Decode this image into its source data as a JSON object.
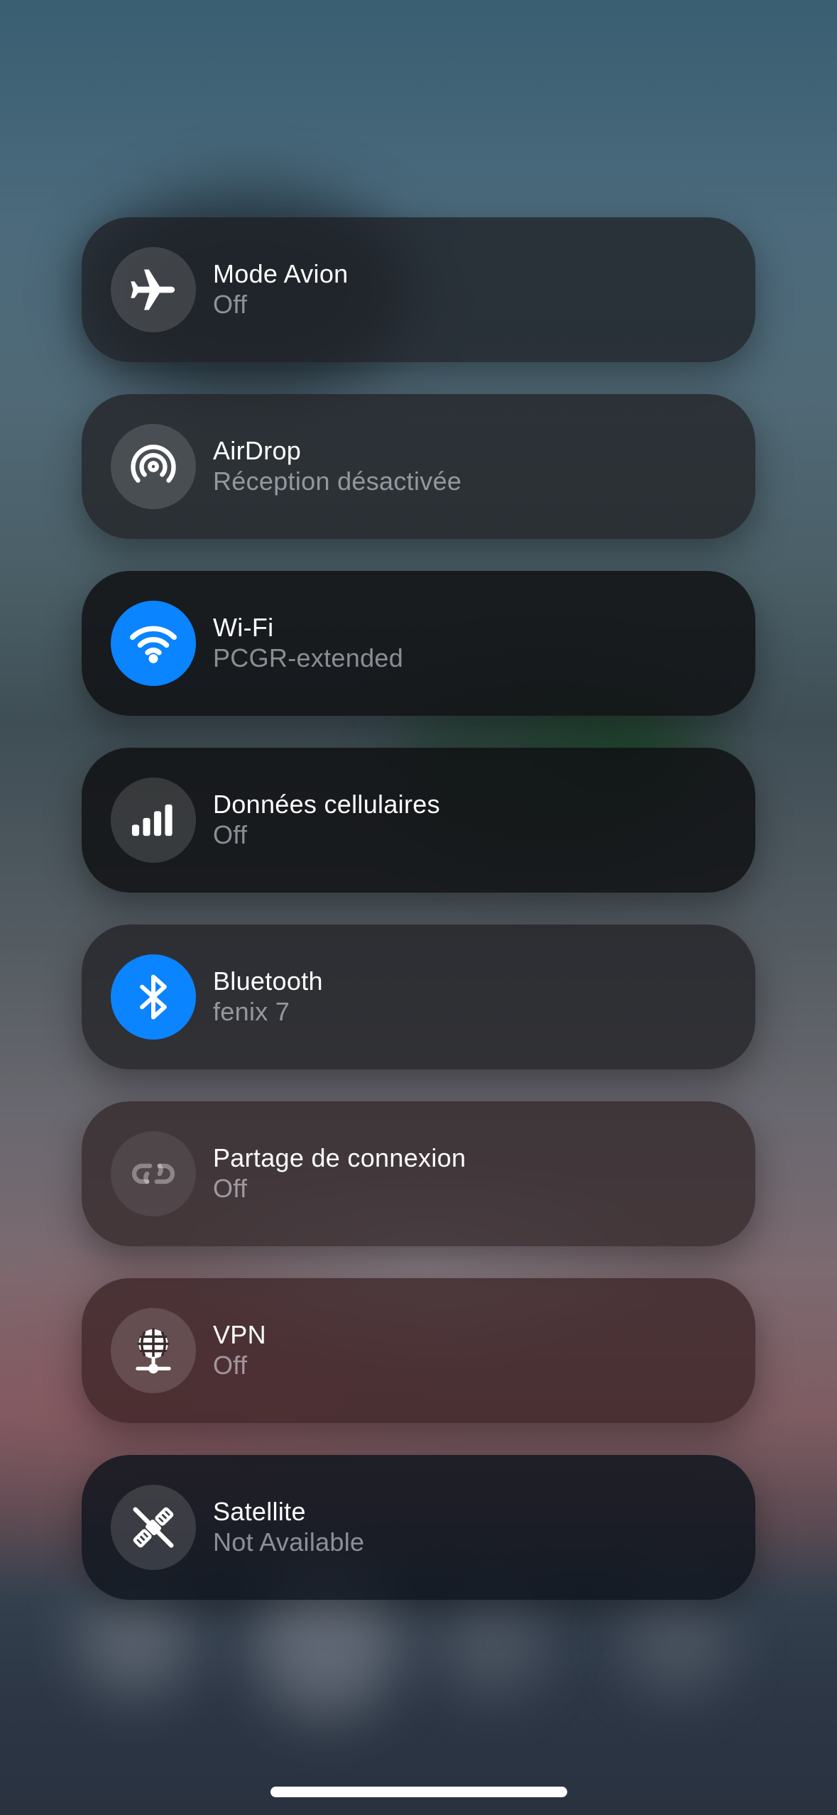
{
  "tiles": [
    {
      "title": "Mode Avion",
      "subtitle": "Off",
      "icon": "airplane-icon",
      "active": false
    },
    {
      "title": "AirDrop",
      "subtitle": "Réception désactivée",
      "icon": "airdrop-icon",
      "active": false
    },
    {
      "title": "Wi-Fi",
      "subtitle": "PCGR-extended",
      "icon": "wifi-icon",
      "active": true
    },
    {
      "title": "Données cellulaires",
      "subtitle": "Off",
      "icon": "cellular-icon",
      "active": false
    },
    {
      "title": "Bluetooth",
      "subtitle": "fenix 7",
      "icon": "bluetooth-icon",
      "active": true
    },
    {
      "title": "Partage de connexion",
      "subtitle": "Off",
      "icon": "hotspot-icon",
      "active": false
    },
    {
      "title": "VPN",
      "subtitle": "Off",
      "icon": "vpn-globe-icon",
      "active": false
    },
    {
      "title": "Satellite",
      "subtitle": "Not Available",
      "icon": "satellite-off-icon",
      "active": false
    }
  ],
  "colors": {
    "active_blue": "#0a84ff",
    "title_text": "#ffffff",
    "subtitle_text": "#8e8e93"
  }
}
